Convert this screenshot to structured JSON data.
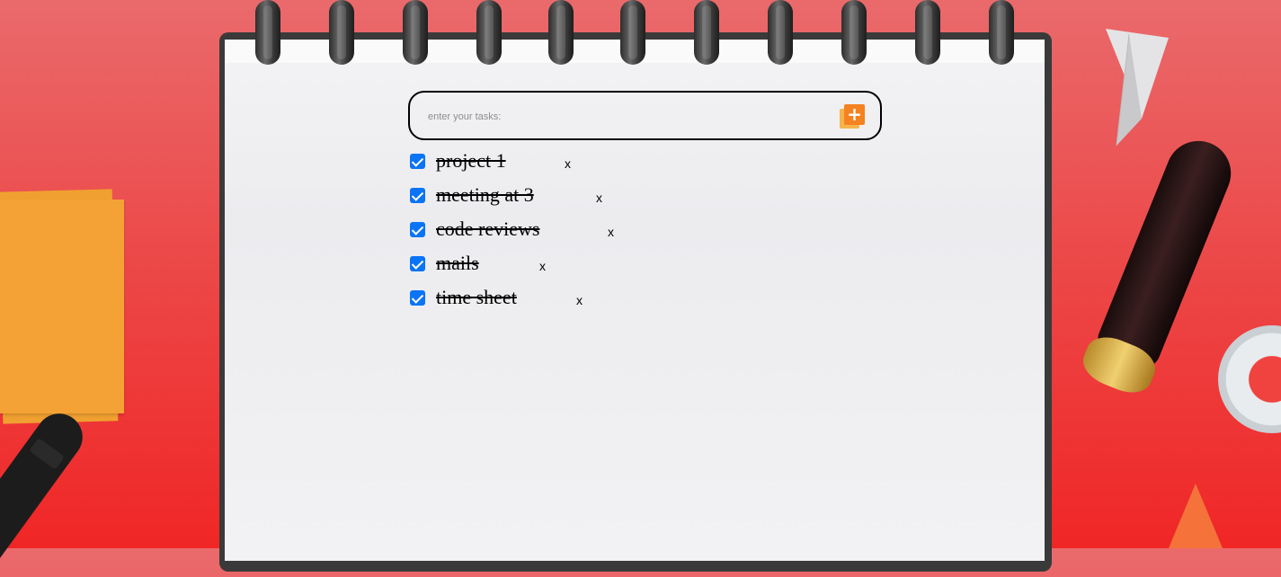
{
  "task_input": {
    "placeholder": "enter your tasks:",
    "value": ""
  },
  "add_button": {
    "icon": "add-square-icon",
    "colors": {
      "front": "#f58220",
      "back": "#f6b34b"
    }
  },
  "tasks": [
    {
      "label": "project 1",
      "done": true,
      "delete_label": "x"
    },
    {
      "label": "meeting at 3",
      "done": true,
      "delete_label": "x"
    },
    {
      "label": "code reviews ",
      "done": true,
      "delete_label": "x"
    },
    {
      "label": "mails ",
      "done": true,
      "delete_label": "x"
    },
    {
      "label": "time sheet",
      "done": true,
      "delete_label": "x"
    }
  ],
  "colors": {
    "background": "#ef3b3b",
    "checkbox": "#0a74f5",
    "page": "#efeff1"
  }
}
